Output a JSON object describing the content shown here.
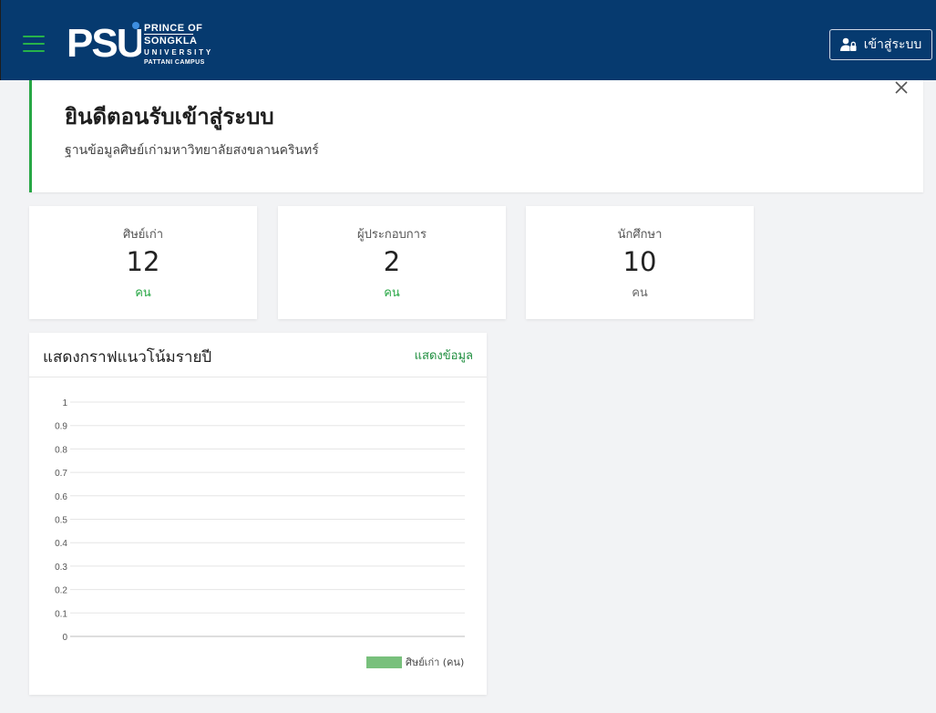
{
  "header": {
    "logo_mark": "PSU",
    "logo_lines": [
      "PRINCE OF",
      "SONGKLA",
      "UNIVERSITY",
      "PATTANI CAMPUS"
    ],
    "login_label": "เข้าสู่ระบบ",
    "bg_color": "#063a6f",
    "accent": "#27b24a"
  },
  "welcome": {
    "title": "ยินดีตอนรับเข้าสู่ระบบ",
    "subtitle": "ฐานข้อมูลศิษย์เก่ามหาวิทยาลัยสงขลานครินทร์"
  },
  "stats": [
    {
      "label": "ศิษย์เก่า",
      "value": "12",
      "unit": "คน",
      "unit_color": "#28a745"
    },
    {
      "label": "ผู้ประกอบการ",
      "value": "2",
      "unit": "คน",
      "unit_color": "#28a745"
    },
    {
      "label": "นักศึกษา",
      "value": "10",
      "unit": "คน",
      "unit_color": "#666666"
    }
  ],
  "chart_card": {
    "title": "แสดงกราฟแนวโน้มรายปี",
    "link": "แสดงข้อมูล"
  },
  "chart_data": {
    "type": "line",
    "title": "",
    "xlabel": "",
    "ylabel": "",
    "ylim": [
      0,
      1
    ],
    "yticks": [
      "0",
      "0.1",
      "0.2",
      "0.3",
      "0.4",
      "0.5",
      "0.6",
      "0.7",
      "0.8",
      "0.9",
      "1"
    ],
    "categories": [],
    "series": [
      {
        "name": "ศิษย์เก่า (คน)",
        "values": [],
        "color": "#78c07c"
      }
    ],
    "grid": true,
    "legend": "bottom-right"
  }
}
